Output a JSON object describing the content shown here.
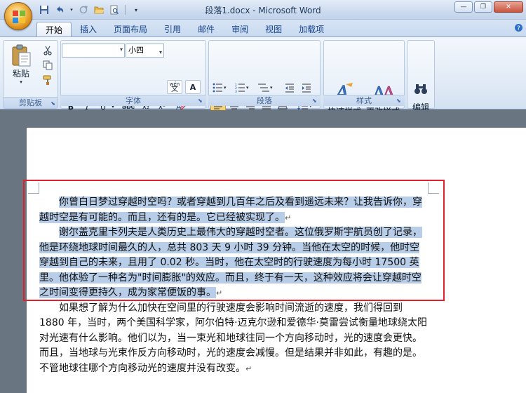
{
  "window": {
    "title": "段落1.docx - Microsoft Word"
  },
  "quick_access": [
    "save-icon",
    "undo-icon",
    "redo-icon",
    "open-icon",
    "print-preview-icon"
  ],
  "tabs": [
    {
      "label": "开始",
      "active": true
    },
    {
      "label": "插入",
      "active": false
    },
    {
      "label": "页面布局",
      "active": false
    },
    {
      "label": "引用",
      "active": false
    },
    {
      "label": "邮件",
      "active": false
    },
    {
      "label": "审阅",
      "active": false
    },
    {
      "label": "视图",
      "active": false
    },
    {
      "label": "加载项",
      "active": false
    }
  ],
  "ribbon": {
    "clipboard": {
      "label": "剪贴板",
      "paste_label": "粘贴"
    },
    "font": {
      "label": "字体",
      "font_name": "",
      "font_size": "小四",
      "wen": "wén"
    },
    "paragraph": {
      "label": "段落"
    },
    "styles": {
      "label": "样式",
      "quick_styles": "快速样式",
      "change_styles": "更改样式"
    },
    "editing": {
      "label": "编辑"
    }
  },
  "document": {
    "paragraphs": [
      {
        "text": "你曾白日梦过穿越时空吗？或者穿越到几百年之后及看到遥远未来？让我告诉你，穿越时空是有可能的。而且，还有的是。它已经被实现了。",
        "selected": true
      },
      {
        "text": "谢尔盖克里卡列夫是人类历史上最伟大的穿越时空者。这位俄罗斯宇航员创了记录，他是环绕地球时间最久的人，总共 803 天 9 小时 39 分钟。当他在太空的时候，他时空穿越到自己的未来，且用了 0.02 秒。当时，他在太空时的行驶速度为每小时 17500 英里。他体验了一种名为\"时间膨胀\"的效应。而且，终于有一天，这种效应将会让穿越时空之时间变得更持久，成为家常便饭的事。",
        "selected": true
      },
      {
        "text": "如果想了解为什么加快在空间里的行驶速度会影响时间流逝的速度，我们得回到 1880 年，当时，两个美国科学家，阿尔伯特·迈克尔逊和爱德华·莫雷尝试衡量地球绕太阳对光速有什么影响。他们以为，当一束光和地球往同一个方向移动时，光的速度会更快。而且，当地球与光束作反方向移动时，光的速度会减慢。但是结果并非如此，有趣的是。不管地球往哪个方向移动光的速度并没有改变。",
        "selected": false
      }
    ],
    "paragraph_mark": "↵"
  },
  "colors": {
    "selection": "#b7cde8",
    "highlight_box": "#e2202a",
    "ribbon_text": "#15428b"
  }
}
